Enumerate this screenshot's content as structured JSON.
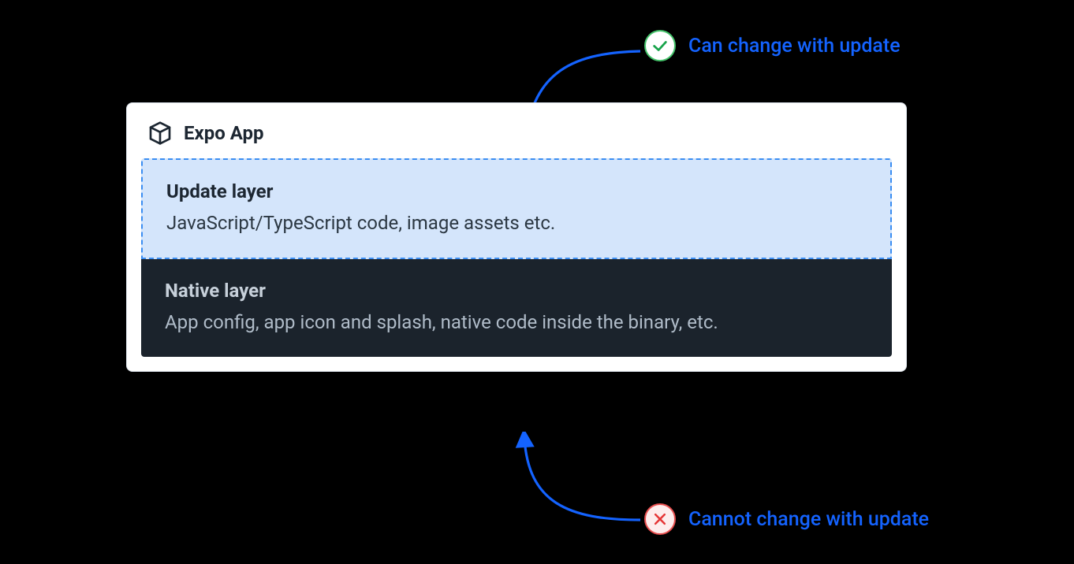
{
  "card": {
    "title": "Expo App"
  },
  "update_layer": {
    "title": "Update layer",
    "description": "JavaScript/TypeScript code, image assets etc."
  },
  "native_layer": {
    "title": "Native layer",
    "description": "App config, app icon and splash, native code inside the binary, etc."
  },
  "callouts": {
    "can": "Can change with update",
    "cannot": "Cannot change with update"
  },
  "colors": {
    "accent_blue": "#1463ff",
    "dash_blue": "#3a8df2",
    "light_blue_bg": "#d4e5fb",
    "dark_panel": "#1b232c",
    "green": "#44c36a",
    "red": "#e74d4d"
  }
}
